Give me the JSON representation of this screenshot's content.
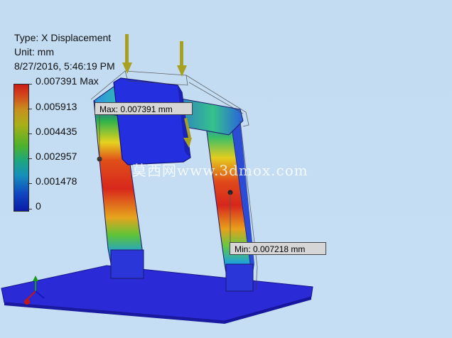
{
  "info": {
    "type": "Type: X Displacement",
    "unit": "Unit: mm",
    "timestamp": "8/27/2016, 5:46:19 PM"
  },
  "legend": {
    "labels": [
      "0.007391 Max",
      "0.005913",
      "0.004435",
      "0.002957",
      "0.001478",
      "0"
    ]
  },
  "probes": {
    "max": "Max: 0.007391 mm",
    "min": "Min: 0.007218 mm"
  },
  "watermark": "莫西网www.3dmox.com",
  "colors": {
    "background": "#c4dcf3",
    "max_red": "#c81d14",
    "min_blue": "#0a1aa8",
    "load_arrow": "#a8a020",
    "base_plate": "#2b2ad8"
  },
  "icons": [
    "load-arrow-icon",
    "axis-triad-icon"
  ]
}
